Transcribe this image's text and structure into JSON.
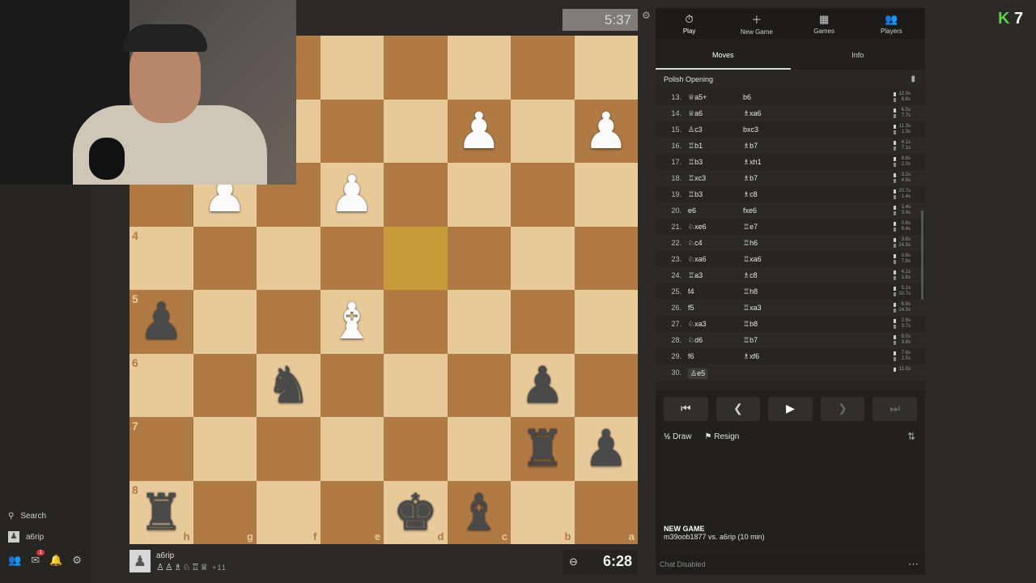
{
  "sidebar": {
    "search_label": "Search",
    "user_label": "a6rip",
    "notif_count": "1"
  },
  "top_clock": "5:37",
  "bottom_player": {
    "name": "a6rip",
    "captured": "♙♙♗♘♖♕",
    "extra": "+11"
  },
  "bottom_clock": "6:28",
  "nav": [
    {
      "label": "Play",
      "icon": "⏱"
    },
    {
      "label": "New Game",
      "icon": "＋"
    },
    {
      "label": "Games",
      "icon": "▦"
    },
    {
      "label": "Players",
      "icon": "👥"
    }
  ],
  "subtabs": [
    "Moves",
    "Info"
  ],
  "opening": "Polish Opening",
  "moves": [
    {
      "n": "13.",
      "w": "♕a5+",
      "b": "b6",
      "tw": "12.9s",
      "tb": "6.8s"
    },
    {
      "n": "14.",
      "w": "♕a6",
      "b": "♗xa6",
      "tw": "6.5s",
      "tb": "7.7s"
    },
    {
      "n": "15.",
      "w": "♙c3",
      "b": "bxc3",
      "tw": "11.3s",
      "tb": "1.3s"
    },
    {
      "n": "16.",
      "w": "♖b1",
      "b": "♗b7",
      "tw": "4.1s",
      "tb": "7.1s"
    },
    {
      "n": "17.",
      "w": "♖b3",
      "b": "♗xh1",
      "tw": "9.8s",
      "tb": "2.0s"
    },
    {
      "n": "18.",
      "w": "♖xc3",
      "b": "♗b7",
      "tw": "3.2s",
      "tb": "4.6s"
    },
    {
      "n": "19.",
      "w": "♖b3",
      "b": "♗c8",
      "tw": "20.7s",
      "tb": "1.4s"
    },
    {
      "n": "20.",
      "w": "e6",
      "b": "fxe6",
      "tw": "1.4s",
      "tb": "3.4s"
    },
    {
      "n": "21.",
      "w": "♘xe6",
      "b": "♖e7",
      "tw": "0.8s",
      "tb": "9.4s"
    },
    {
      "n": "22.",
      "w": "♘c4",
      "b": "♖h6",
      "tw": "3.8s",
      "tb": "24.5s"
    },
    {
      "n": "23.",
      "w": "♘xa6",
      "b": "♖xa6",
      "tw": "0.8s",
      "tb": "7.8s"
    },
    {
      "n": "24.",
      "w": "♖a3",
      "b": "♗c8",
      "tw": "4.1s",
      "tb": "1.6s"
    },
    {
      "n": "25.",
      "w": "f4",
      "b": "♖h8",
      "tw": "5.1s",
      "tb": "10.7s"
    },
    {
      "n": "26.",
      "w": "f5",
      "b": "♖xa3",
      "tw": "6.9s",
      "tb": "14.3s"
    },
    {
      "n": "27.",
      "w": "♘xa3",
      "b": "♖b8",
      "tw": "2.6s",
      "tb": "3.7s"
    },
    {
      "n": "28.",
      "w": "♘d6",
      "b": "♖b7",
      "tw": "8.0s",
      "tb": "3.8s"
    },
    {
      "n": "29.",
      "w": "f6",
      "b": "♗xf6",
      "tw": "7.6s",
      "tb": "2.5s"
    },
    {
      "n": "30.",
      "w": "♙e5",
      "b": "",
      "tw": "11.0s",
      "tb": ""
    }
  ],
  "actions": {
    "draw": "Draw",
    "draw_icon": "½",
    "resign": "Resign"
  },
  "new_game": {
    "heading": "NEW GAME",
    "desc": "m39oob1877 vs. a6rip (10 min)"
  },
  "chat": "Chat Disabled",
  "corner_badge": {
    "letter": "K",
    "count": "7"
  },
  "board": {
    "ranks": [
      "",
      "",
      "",
      "4",
      "5",
      "6",
      "7",
      "8"
    ],
    "files": [
      "h",
      "g",
      "f",
      "e",
      "d",
      "c",
      "b",
      "a"
    ],
    "highlight": "3,4"
  }
}
